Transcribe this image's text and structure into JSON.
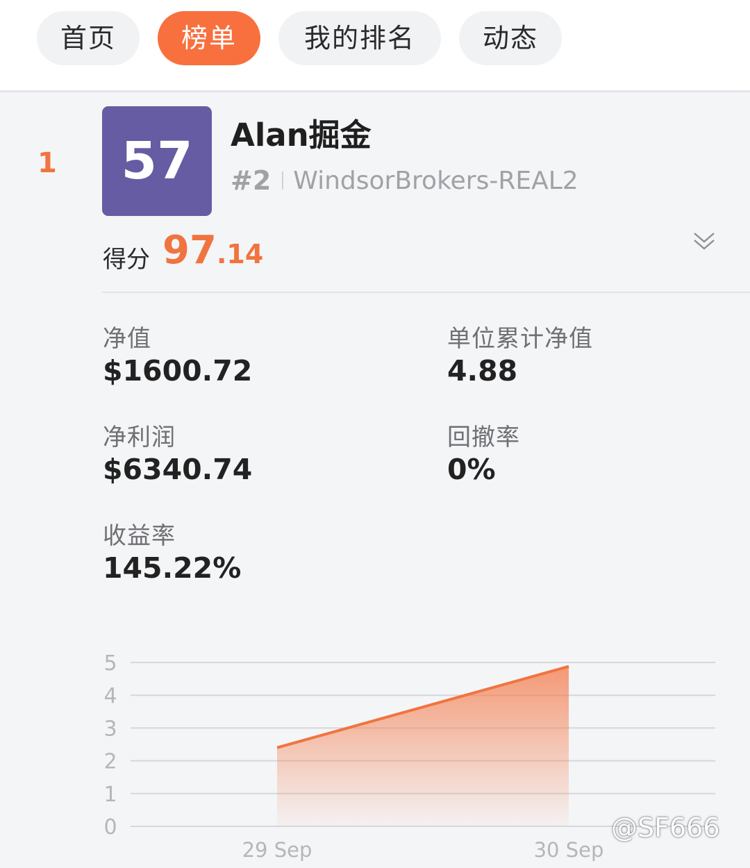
{
  "tabs": [
    {
      "label": "首页",
      "active": false
    },
    {
      "label": "榜单",
      "active": true
    },
    {
      "label": "我的排名",
      "active": false
    },
    {
      "label": "动态",
      "active": false
    }
  ],
  "entry": {
    "rank": "1",
    "score_badge": "57",
    "name": "Alan掘金",
    "server_rank": "#2",
    "server": "WindsorBrokers-REAL2",
    "score_label": "得分",
    "score_int": "97",
    "score_frac": ".14",
    "expand_icon": "chevron-double-down-icon"
  },
  "stats": {
    "equity": {
      "label": "净值",
      "value": "$1600.72"
    },
    "unit_nav": {
      "label": "单位累计净值",
      "value": "4.88"
    },
    "net_profit": {
      "label": "净利润",
      "value": "$6340.74"
    },
    "drawdown": {
      "label": "回撤率",
      "value": "0%"
    },
    "return_rate": {
      "label": "收益率",
      "value": "145.22%"
    }
  },
  "chart_data": {
    "type": "area",
    "title": "",
    "xlabel": "",
    "ylabel": "",
    "x": [
      "29 Sep",
      "30 Sep"
    ],
    "series": [
      {
        "values": [
          2.4,
          4.88
        ]
      }
    ],
    "y_ticks": [
      "0",
      "1",
      "2",
      "3",
      "4",
      "5"
    ],
    "ylim": [
      0,
      5
    ],
    "grid": true,
    "color": "#f0743f"
  },
  "watermark": "@SF666",
  "colors": {
    "accent": "#f7703e",
    "badge": "#655ca3",
    "muted": "#a1a1a6"
  }
}
